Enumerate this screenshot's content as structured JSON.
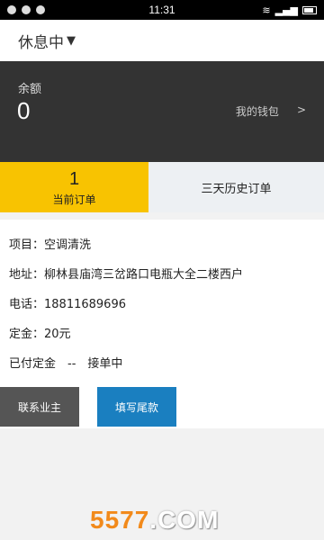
{
  "statusbar": {
    "time": "11:31"
  },
  "header": {
    "status": "休息中",
    "arrow": "▼"
  },
  "balance": {
    "label": "余额",
    "amount": "0",
    "wallet_label": "我的钱包",
    "chevron": ">"
  },
  "tabs": {
    "current": {
      "count": "1",
      "label": "当前订单"
    },
    "history": {
      "label": "三天历史订单"
    }
  },
  "order": {
    "project": "项目：空调清洗",
    "address": "地址：柳林县庙湾三岔路口电瓶大全二楼西户",
    "phone": "电话：18811689696",
    "deposit": "定金：20元",
    "paid_status": "已付定金　--　接单中",
    "buttons": {
      "contact": "联系业主",
      "fill_balance": "填写尾款"
    }
  },
  "watermark": {
    "number": "5577",
    "domain": ".COM"
  }
}
